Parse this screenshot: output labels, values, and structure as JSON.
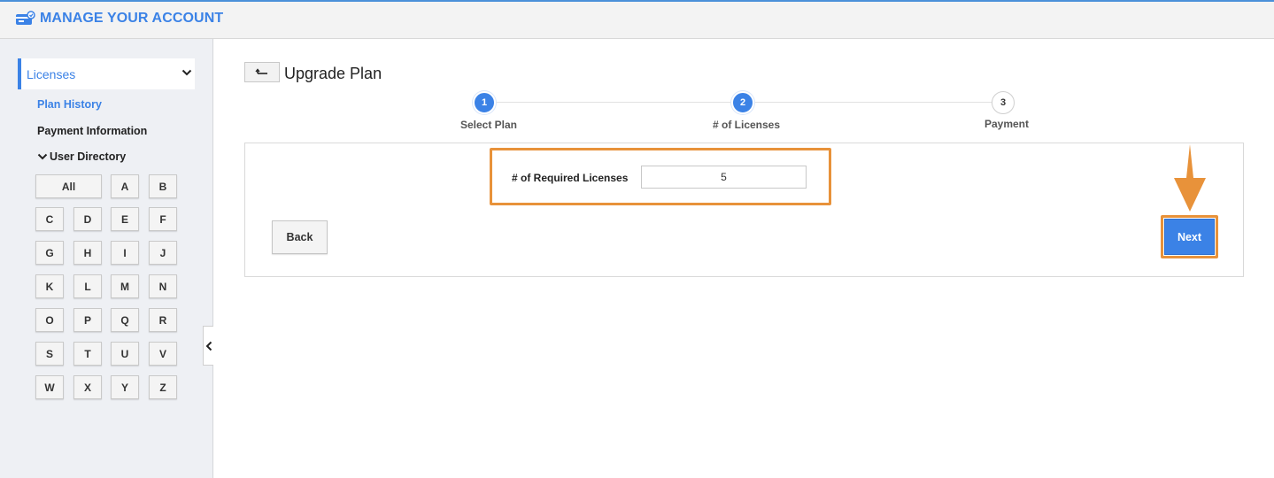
{
  "header": {
    "title": "MANAGE YOUR ACCOUNT",
    "icon": "account-card-icon"
  },
  "colors": {
    "accent": "#3b82e6",
    "highlight": "#e8923a",
    "sidebar_bg": "#eef0f4"
  },
  "sidebar": {
    "dropdown_label": "Licenses",
    "links": [
      {
        "label": "Plan History",
        "active": true
      },
      {
        "label": "Payment Information",
        "active": false
      }
    ],
    "user_directory_label": "User Directory",
    "letters": [
      "All",
      "A",
      "B",
      "C",
      "D",
      "E",
      "F",
      "G",
      "H",
      "I",
      "J",
      "K",
      "L",
      "M",
      "N",
      "O",
      "P",
      "Q",
      "R",
      "S",
      "T",
      "U",
      "V",
      "W",
      "X",
      "Y",
      "Z"
    ]
  },
  "main": {
    "title": "Upgrade Plan",
    "steps": [
      {
        "number": "1",
        "label": "Select Plan",
        "state": "done"
      },
      {
        "number": "2",
        "label": "# of Licenses",
        "state": "current"
      },
      {
        "number": "3",
        "label": "Payment",
        "state": "todo"
      }
    ],
    "required_licenses_label": "# of Required Licenses",
    "required_licenses_value": "5",
    "back_label": "Back",
    "next_label": "Next"
  }
}
